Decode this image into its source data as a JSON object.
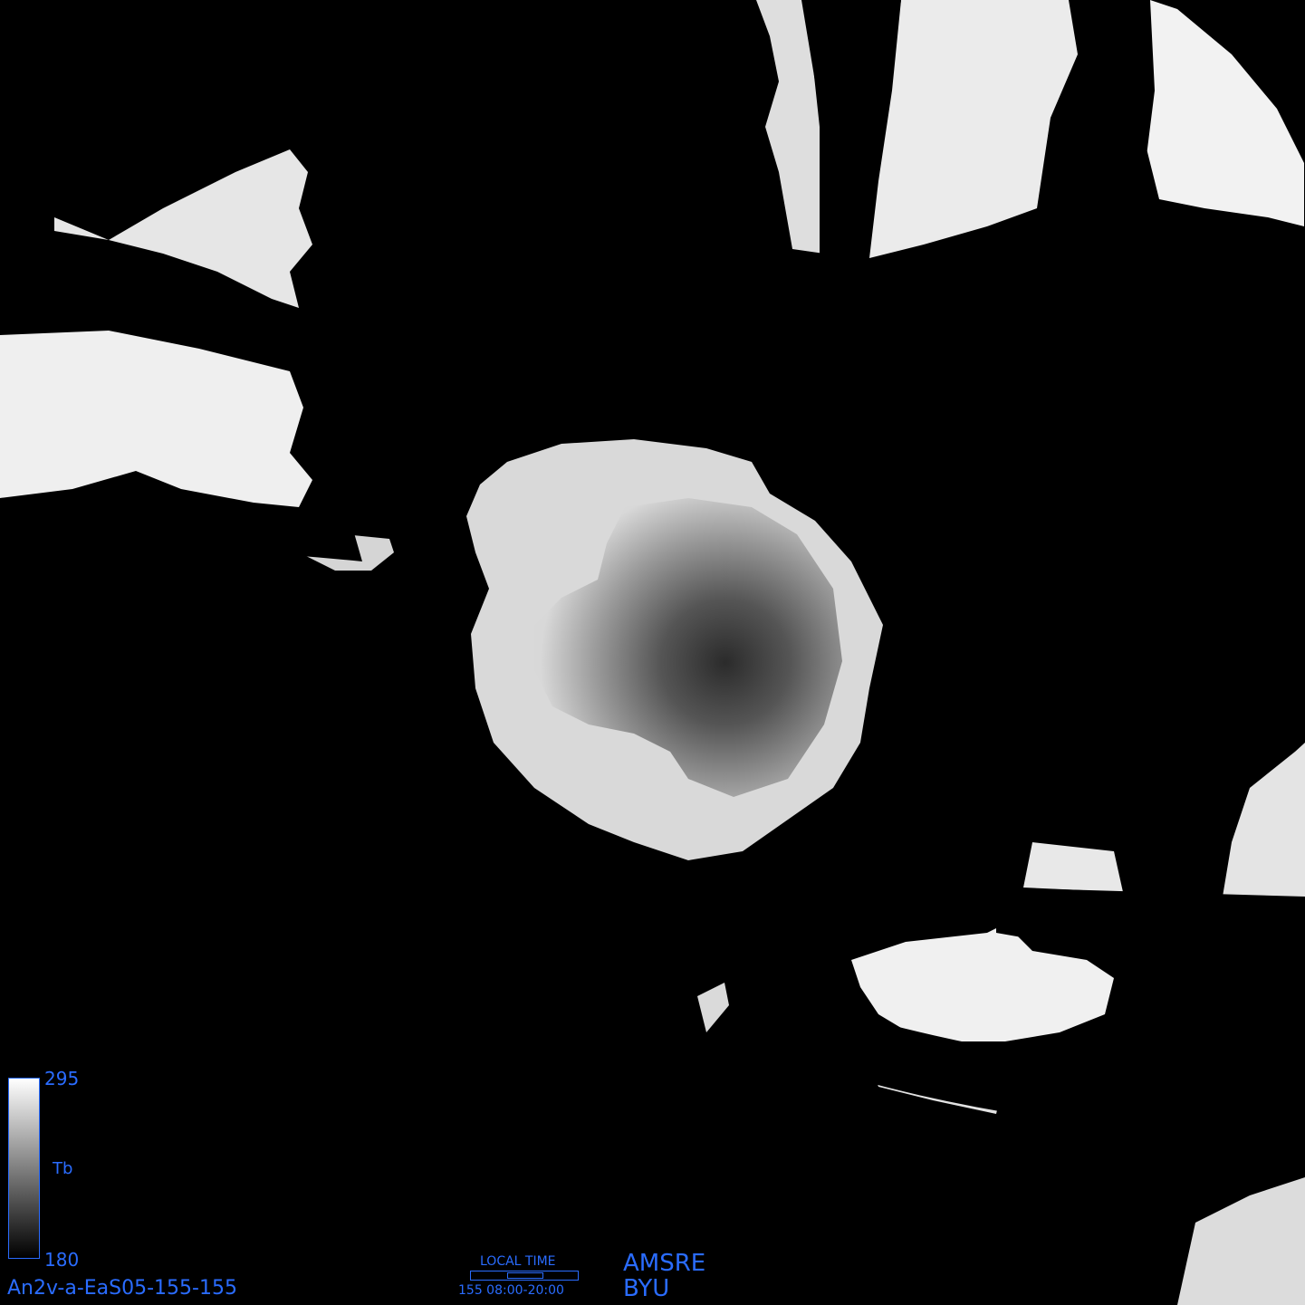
{
  "image_id": "An2v-a-EaS05-155-155",
  "colorbar": {
    "max": "295",
    "min": "180",
    "unit": "Tb"
  },
  "local_time": {
    "title": "LOCAL TIME",
    "range": "155 08:00-20:00"
  },
  "sensor": "AMSRE",
  "organization": "BYU",
  "colors": {
    "label": "#2a6cff",
    "background": "#000000"
  }
}
